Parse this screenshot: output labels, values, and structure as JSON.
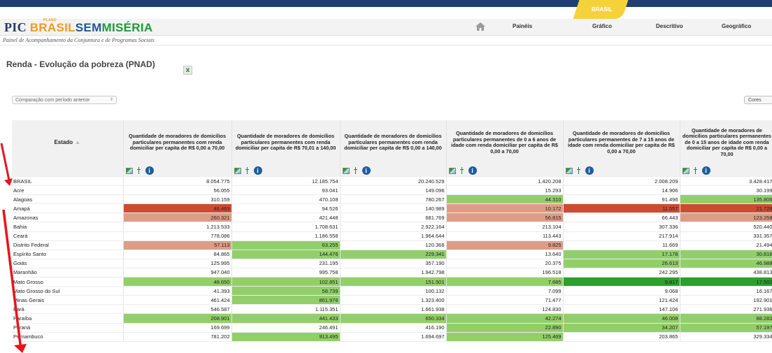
{
  "header": {
    "brand_pic": "PIC",
    "brand_plano": "PLANO",
    "brand_brasil": "BRASIL",
    "brand_sem": "SEM",
    "brand_miseria": "MISÉRIA",
    "tab_label": "BRASIL",
    "nav": [
      "Painéis",
      "Gráfico",
      "Descritivo",
      "Geográfico"
    ],
    "subtitle": "Painel de Acompanhamento da Conjuntura e de Programas Sociais"
  },
  "page": {
    "title": "Renda - Evolução da pobreza (PNAD)",
    "excel_icon": "x",
    "comparison_select": "Comparação com período anterior",
    "colors_button": "Cores"
  },
  "table": {
    "estado_header": "Estado",
    "sort_indicator": "▲",
    "columns": [
      "Quantidade de moradores de domicílios particulares permanentes com renda domiciliar per capita de R$ 0,00 a 70,00",
      "Quantidade de moradores de domicílios particulares permanentes com renda domiciliar per capita de R$ 70,01 a 140,00",
      "Quantidade de moradores de domicílios particulares permanentes com renda domiciliar per capita de R$ 0,00 a 140,00",
      "Quantidade de moradores de domicílios particulares permanentes de 0 a 6 anos de idade com renda domiciliar per capita de R$ 0,00 a 70,00",
      "Quantidade de moradores de domicílios particulares permanentes de 7 a 15 anos de idade com renda domiciliar per capita de R$ 0,00 a 70,00",
      "Quantidade de moradores de domicílios particulares permanentes de 0 a 15 anos de idade com renda domiciliar per capita de R$ 0,00 a 70,00"
    ],
    "rows": [
      {
        "name": "BRASIL",
        "values": [
          "8.054.775",
          "12.185.754",
          "20.240.529",
          "1.420.208",
          "2.008.209",
          "3.428.417"
        ],
        "colors": [
          "",
          "",
          "",
          "",
          "",
          ""
        ]
      },
      {
        "name": "Acre",
        "values": [
          "56.055",
          "93.041",
          "149.096",
          "15.293",
          "14.906",
          "30.199"
        ],
        "colors": [
          "",
          "",
          "",
          "",
          "",
          ""
        ]
      },
      {
        "name": "Alagoas",
        "values": [
          "310.159",
          "470.108",
          "780.267",
          "44.310",
          "91.496",
          "135.806"
        ],
        "colors": [
          "",
          "",
          "",
          "lg",
          "",
          "lg"
        ]
      },
      {
        "name": "Amapá",
        "values": [
          "46.463",
          "94.526",
          "140.989",
          "10.172",
          "11.557",
          "21.729"
        ],
        "colors": [
          "dr",
          "",
          "",
          "lr",
          "dr",
          "dr"
        ]
      },
      {
        "name": "Amazonas",
        "values": [
          "260.321",
          "421.448",
          "681.769",
          "56.815",
          "66.443",
          "123.258"
        ],
        "colors": [
          "lr",
          "",
          "",
          "lr",
          "",
          "lr"
        ]
      },
      {
        "name": "Bahia",
        "values": [
          "1.213.533",
          "1.708.631",
          "2.922.164",
          "213.104",
          "307.336",
          "520.440"
        ],
        "colors": [
          "",
          "",
          "",
          "",
          "",
          ""
        ]
      },
      {
        "name": "Ceará",
        "values": [
          "778.086",
          "1.186.558",
          "1.964.644",
          "113.443",
          "217.914",
          "331.357"
        ],
        "colors": [
          "",
          "",
          "",
          "",
          "",
          ""
        ]
      },
      {
        "name": "Distrito Federal",
        "values": [
          "57.113",
          "63.255",
          "120.368",
          "9.825",
          "11.669",
          "21.494"
        ],
        "colors": [
          "lr",
          "lg",
          "",
          "lr",
          "",
          ""
        ]
      },
      {
        "name": "Espírito Santo",
        "values": [
          "84.865",
          "144.476",
          "229.341",
          "13.640",
          "17.178",
          "30.818"
        ],
        "colors": [
          "",
          "lg",
          "lg",
          "",
          "lg",
          "lg"
        ]
      },
      {
        "name": "Goiás",
        "values": [
          "125.995",
          "231.195",
          "357.190",
          "20.375",
          "26.613",
          "46.988"
        ],
        "colors": [
          "",
          "",
          "",
          "",
          "lg",
          "lg"
        ]
      },
      {
        "name": "Maranhão",
        "values": [
          "947.040",
          "995.758",
          "1.942.798",
          "196.518",
          "242.295",
          "438.813"
        ],
        "colors": [
          "",
          "",
          "",
          "",
          "",
          ""
        ]
      },
      {
        "name": "Mato Grosso",
        "values": [
          "48.650",
          "102.851",
          "151.501",
          "7.685",
          "9.817",
          "17.502"
        ],
        "colors": [
          "lg",
          "lg",
          "lg",
          "lg",
          "dg",
          "dg"
        ]
      },
      {
        "name": "Mato Grosso do Sul",
        "values": [
          "41.393",
          "58.739",
          "100.132",
          "7.099",
          "9.068",
          "16.167"
        ],
        "colors": [
          "",
          "lg",
          "",
          "",
          "",
          ""
        ]
      },
      {
        "name": "Minas Gerais",
        "values": [
          "461.424",
          "861.976",
          "1.323.400",
          "71.477",
          "121.424",
          "192.901"
        ],
        "colors": [
          "",
          "lg",
          "",
          "",
          "",
          ""
        ]
      },
      {
        "name": "Pará",
        "values": [
          "546.587",
          "1.115.351",
          "1.661.938",
          "124.830",
          "147.106",
          "271.936"
        ],
        "colors": [
          "",
          "",
          "",
          "",
          "",
          ""
        ]
      },
      {
        "name": "Paraíba",
        "values": [
          "208.901",
          "441.433",
          "650.334",
          "42.274",
          "46.008",
          "88.282"
        ],
        "colors": [
          "lg",
          "lg",
          "lg",
          "lg",
          "lg",
          "lg"
        ]
      },
      {
        "name": "Paraná",
        "values": [
          "169.699",
          "246.491",
          "416.190",
          "22.890",
          "34.207",
          "57.197"
        ],
        "colors": [
          "",
          "",
          "",
          "lg",
          "lg",
          "lg"
        ]
      },
      {
        "name": "Pernambuco",
        "values": [
          "781.202",
          "913.495",
          "1.694.697",
          "125.469",
          "203.865",
          "329.334"
        ],
        "colors": [
          "",
          "lg",
          "",
          "lg",
          "",
          ""
        ]
      }
    ]
  },
  "icons": {
    "home": "home-icon",
    "chart": "chart-icon",
    "sort": "sort-icon",
    "info": "info-icon",
    "excel": "excel-icon"
  },
  "colors": {
    "topbar": "#1f3f73",
    "light_green": "#92cf6b",
    "dark_green": "#2e9e2f",
    "dark_red": "#cd4b33",
    "light_red": "#de9c87",
    "annotation_arrow": "#e8141c"
  }
}
